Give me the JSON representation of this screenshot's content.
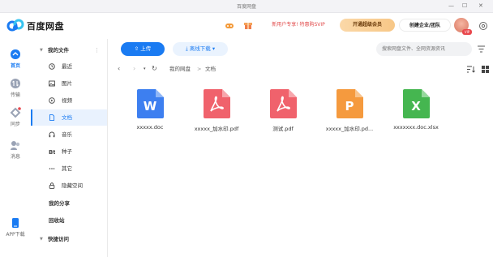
{
  "titlebar": {
    "title": "百度网盘",
    "minimize": "—",
    "maximize": "☐",
    "close": "✕"
  },
  "header": {
    "brand": "百度网盘",
    "promo_label": "新用户专享! 特惠购SVIP",
    "vip_button": "开通超级会员",
    "enterprise_button": "创建企业/团队",
    "avatar_badge": "VIP",
    "colors": {
      "accent": "#1a7bf2",
      "promo": "#e14b4b",
      "gold": "#f7c787"
    }
  },
  "rail": [
    {
      "label": "首页",
      "icon": "home-icon",
      "active": true
    },
    {
      "label": "传输",
      "icon": "transfer-icon",
      "active": false
    },
    {
      "label": "同步",
      "icon": "sync-icon",
      "active": false
    },
    {
      "label": "消息",
      "icon": "message-icon",
      "active": false
    },
    {
      "label": "APP下载",
      "icon": "app-download-icon",
      "active": false
    }
  ],
  "nav": {
    "my_files": "我的文件",
    "items": [
      {
        "label": "最近",
        "icon": "clock-icon"
      },
      {
        "label": "图片",
        "icon": "image-icon"
      },
      {
        "label": "视频",
        "icon": "video-icon"
      },
      {
        "label": "文档",
        "icon": "document-icon",
        "active": true
      },
      {
        "label": "音乐",
        "icon": "headphones-icon"
      },
      {
        "label": "种子",
        "icon": "torrent-icon"
      },
      {
        "label": "其它",
        "icon": "more-icon"
      },
      {
        "label": "隐藏空间",
        "icon": "lock-icon"
      }
    ],
    "my_share": "我的分享",
    "recycle_bin": "回收站",
    "quick_access": "快捷访问"
  },
  "toolbar": {
    "upload_label": "上传",
    "offline_label": "离线下载",
    "search_placeholder": "搜索网盘文件、全网资源资讯"
  },
  "path": {
    "root": "我的网盘",
    "separator": ">",
    "current": "文档"
  },
  "files": [
    {
      "name": "xxxxx.doc",
      "type": "word",
      "letter": "W",
      "color": "#3d7ff0"
    },
    {
      "name": "xxxxx_加水印.pdf",
      "type": "pdf",
      "letter": "pdf",
      "color": "#f0626c"
    },
    {
      "name": "测试.pdf",
      "type": "pdf",
      "letter": "pdf",
      "color": "#f0626c"
    },
    {
      "name": "xxxxx_加水印.pd...",
      "type": "ppt",
      "letter": "P",
      "color": "#f59a3e"
    },
    {
      "name": "xxxxxxx.doc.xlsx",
      "type": "excel",
      "letter": "X",
      "color": "#45b650"
    }
  ]
}
